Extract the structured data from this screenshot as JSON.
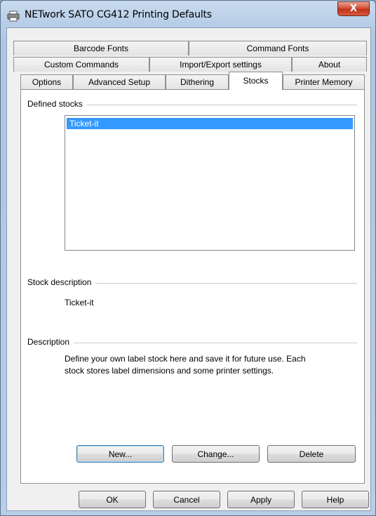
{
  "window": {
    "title": "NETwork SATO CG412 Printing Defaults",
    "close_glyph": "X"
  },
  "tabs": {
    "row1": [
      {
        "label": "Barcode Fonts"
      },
      {
        "label": "Command Fonts"
      }
    ],
    "row2": [
      {
        "label": "Custom Commands"
      },
      {
        "label": "Import/Export settings"
      },
      {
        "label": "About"
      }
    ],
    "row3": [
      {
        "label": "Options"
      },
      {
        "label": "Advanced Setup"
      },
      {
        "label": "Dithering"
      },
      {
        "label": "Stocks",
        "active": true
      },
      {
        "label": "Printer Memory"
      }
    ]
  },
  "stocks_page": {
    "defined_stocks_label": "Defined stocks",
    "stocks": [
      {
        "name": "Ticket-it",
        "selected": true
      }
    ],
    "stock_description_label": "Stock description",
    "stock_description_value": "Ticket-it",
    "description_label": "Description",
    "description_line1": "Define your own label stock here and save it for future use. Each",
    "description_line2": "stock stores label dimensions and some printer settings.",
    "buttons": {
      "new": "New...",
      "change": "Change...",
      "delete": "Delete"
    }
  },
  "footer": {
    "ok": "OK",
    "cancel": "Cancel",
    "apply": "Apply",
    "help": "Help"
  },
  "colors": {
    "selection": "#3399ff",
    "close_button": "#c7402a",
    "titlebar": "#b9cfe8"
  }
}
